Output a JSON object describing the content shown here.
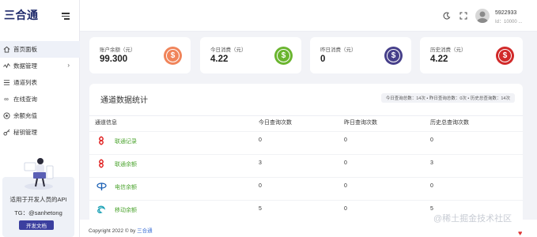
{
  "brand": {
    "logo_text": "三合通"
  },
  "sidebar": {
    "items": [
      {
        "label": "首页面板",
        "icon": "home-icon",
        "active": true
      },
      {
        "label": "数据管理",
        "icon": "chart-line-icon",
        "has_children": true
      },
      {
        "label": "通道列表",
        "icon": "list-icon"
      },
      {
        "label": "在线查询",
        "icon": "infinity-icon"
      },
      {
        "label": "余额充值",
        "icon": "coin-icon"
      },
      {
        "label": "秘钥管理",
        "icon": "key-icon"
      }
    ],
    "promo": {
      "title": "适用于开发人员的API",
      "tg": "TG：@sanhetong",
      "button_label": "开发文档"
    }
  },
  "header": {
    "user_name": "5922933",
    "user_id": "Id：10000 ..."
  },
  "stats": [
    {
      "label": "账户余额（元）",
      "value": "99.300",
      "color": "#f0845a"
    },
    {
      "label": "今日消费（元）",
      "value": "4.22",
      "color": "#6ab52f"
    },
    {
      "label": "昨日消费（元）",
      "value": "0",
      "color": "#463f8a"
    },
    {
      "label": "历史消费（元）",
      "value": "4.22",
      "color": "#d12a2a"
    }
  ],
  "panel": {
    "title": "通道数据统计",
    "summary": "今日查询总数：14次 • 昨日查询总数：0次 • 历史总查询数：14次",
    "headers": [
      "通道信息",
      "今日查询次数",
      "昨日查询次数",
      "历史总查询次数"
    ],
    "rows": [
      {
        "name": "联通记录",
        "logo": "unicom-logo-icon",
        "logo_color": "#e02020",
        "today": "0",
        "yesterday": "0",
        "total": "0"
      },
      {
        "name": "联通余额",
        "logo": "unicom-logo-icon",
        "logo_color": "#e02020",
        "today": "3",
        "yesterday": "0",
        "total": "3"
      },
      {
        "name": "电信余额",
        "logo": "telecom-logo-icon",
        "logo_color": "#1a5fb4",
        "today": "0",
        "yesterday": "0",
        "total": "0"
      },
      {
        "name": "移动余额",
        "logo": "mobile-logo-icon",
        "logo_color": "#19a0b5",
        "today": "5",
        "yesterday": "0",
        "total": "5"
      }
    ]
  },
  "footer": {
    "text": "Copyright 2022 © by",
    "link": "三合通"
  },
  "watermark": "@稀土掘金技术社区"
}
